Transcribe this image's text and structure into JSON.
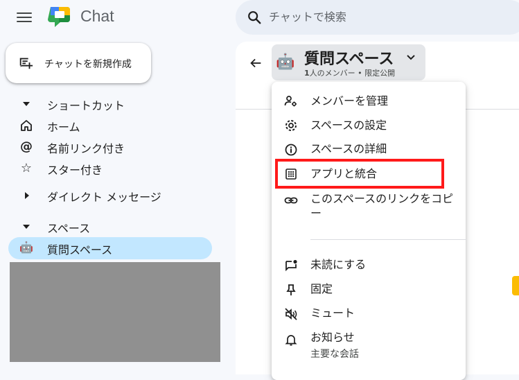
{
  "header": {
    "app_name": "Chat",
    "search_placeholder": "チャットで検索"
  },
  "sidebar": {
    "new_chat_label": "チャットを新規作成",
    "shortcuts_label": "ショートカット",
    "items": [
      {
        "label": "ホーム",
        "icon": "home-icon"
      },
      {
        "label": "名前リンク付き",
        "icon": "at-icon"
      },
      {
        "label": "スター付き",
        "icon": "star-icon"
      }
    ],
    "dm_label": "ダイレクト メッセージ",
    "spaces_label": "スペース",
    "space_item": {
      "emoji": "🤖",
      "label": "質問スペース"
    }
  },
  "space_header": {
    "emoji": "🤖",
    "title": "質問スペース",
    "member_count": "1",
    "member_text": "人のメンバー",
    "separator": "•",
    "visibility": "限定公開"
  },
  "menu": {
    "items": [
      {
        "label": "メンバーを管理",
        "icon": "manage-members-icon"
      },
      {
        "label": "スペースの設定",
        "icon": "settings-icon"
      },
      {
        "label": "スペースの詳細",
        "icon": "info-icon"
      },
      {
        "label": "アプリと統合",
        "icon": "apps-grid-icon"
      },
      {
        "label": "このスペースのリンクをコピー",
        "icon": "link-icon"
      },
      {
        "label": "未読にする",
        "icon": "mark-unread-icon"
      },
      {
        "label": "固定",
        "icon": "pin-icon"
      },
      {
        "label": "ミュート",
        "icon": "mute-icon"
      },
      {
        "label": "お知らせ",
        "sub": "主要な会話",
        "icon": "bell-icon"
      }
    ]
  },
  "colors": {
    "highlight": "#ff1a1a",
    "selected_bg": "#c2e7ff",
    "accent_yellow": "#fbbc04"
  }
}
